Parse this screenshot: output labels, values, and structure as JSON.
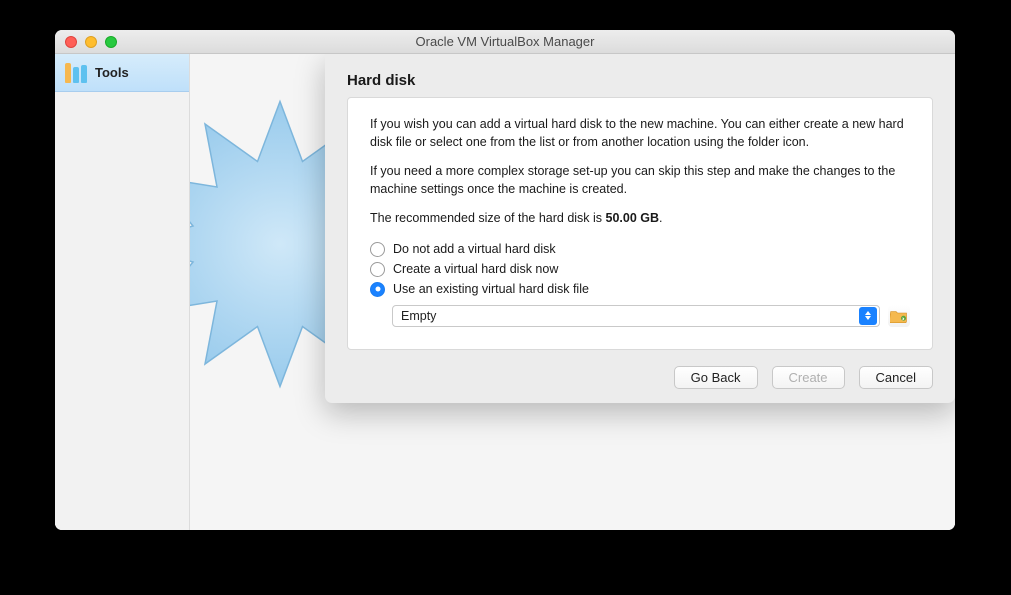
{
  "window": {
    "title": "Oracle VM VirtualBox Manager"
  },
  "sidebar": {
    "tools_label": "Tools"
  },
  "dialog": {
    "heading": "Hard disk",
    "para1": "If you wish you can add a virtual hard disk to the new machine. You can either create a new hard disk file or select one from the list or from another location using the folder icon.",
    "para2": "If you need a more complex storage set-up you can skip this step and make the changes to the machine settings once the machine is created.",
    "recommend_prefix": "The recommended size of the hard disk is ",
    "recommend_size": "50.00 GB",
    "recommend_suffix": ".",
    "options": {
      "none": "Do not add a virtual hard disk",
      "create": "Create a virtual hard disk now",
      "existing": "Use an existing virtual hard disk file"
    },
    "selected_option": "existing",
    "disk_selected": "Empty"
  },
  "buttons": {
    "back": "Go Back",
    "create": "Create",
    "cancel": "Cancel"
  }
}
